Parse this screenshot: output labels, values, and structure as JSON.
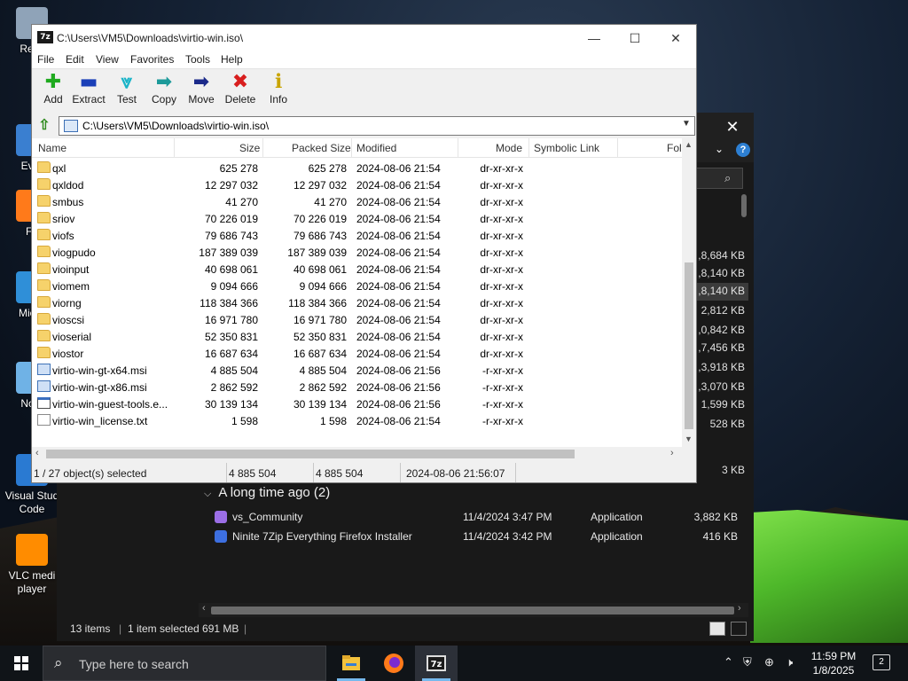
{
  "desktop": {
    "icons": [
      {
        "label": "Recy",
        "icon": "recycle-bin-icon"
      },
      {
        "label": "Ever",
        "icon": "everything-icon"
      },
      {
        "label": "Fir",
        "icon": "firefox-icon"
      },
      {
        "label": "Mic E",
        "icon": "edge-icon"
      },
      {
        "label": "Note",
        "icon": "notepad-icon"
      },
      {
        "label": "Visual Stud Code",
        "icon": "vscode-icon"
      },
      {
        "label": "VLC medi player",
        "icon": "vlc-icon"
      }
    ]
  },
  "explorer": {
    "sizes": [
      ",8,684 KB",
      ",8,140 KB",
      ",8,140 KB",
      "2,812 KB",
      ",0,842 KB",
      ",7,456 KB",
      ",3,918 KB",
      ",3,070 KB",
      "1,599 KB",
      "528 KB",
      "3 KB"
    ],
    "group_label": "A long time ago (2)",
    "rows": [
      {
        "name": "vs_Community",
        "date": "11/4/2024 3:47 PM",
        "type": "Application",
        "size": "3,882 KB",
        "icon": "visual-studio-icon"
      },
      {
        "name": "Ninite 7Zip Everything Firefox Installer",
        "date": "11/4/2024 3:42 PM",
        "type": "Application",
        "size": "416 KB",
        "icon": "ninite-icon"
      }
    ],
    "status": {
      "items": "13 items",
      "selected": "1 item selected  691 MB"
    }
  },
  "zip": {
    "title": "C:\\Users\\VM5\\Downloads\\virtio-win.iso\\",
    "app_icon_text": "7z",
    "menu": [
      "File",
      "Edit",
      "View",
      "Favorites",
      "Tools",
      "Help"
    ],
    "toolbar": [
      {
        "label": "Add",
        "icon": "add-icon",
        "glyph": "✚",
        "color": "#1faa1f"
      },
      {
        "label": "Extract",
        "icon": "extract-icon",
        "glyph": "▬",
        "color": "#1a3fb8"
      },
      {
        "label": "Test",
        "icon": "test-icon",
        "glyph": "⩔",
        "color": "#19b4c8"
      },
      {
        "label": "Copy",
        "icon": "copy-icon",
        "glyph": "➡",
        "color": "#1c9a9a"
      },
      {
        "label": "Move",
        "icon": "move-icon",
        "glyph": "➡",
        "color": "#1b2a8a"
      },
      {
        "label": "Delete",
        "icon": "delete-icon",
        "glyph": "✖",
        "color": "#d81e1e"
      },
      {
        "label": "Info",
        "icon": "info-icon",
        "glyph": "ℹ",
        "color": "#c9a400"
      }
    ],
    "address": "C:\\Users\\VM5\\Downloads\\virtio-win.iso\\",
    "columns": [
      "Name",
      "Size",
      "Packed Size",
      "Modified",
      "Mode",
      "Symbolic Link",
      "Fol"
    ],
    "files": [
      {
        "name": "qxl",
        "size": "625 278",
        "packed": "625 278",
        "modified": "2024-08-06 21:54",
        "mode": "dr-xr-xr-x",
        "type": "folder"
      },
      {
        "name": "qxldod",
        "size": "12 297 032",
        "packed": "12 297 032",
        "modified": "2024-08-06 21:54",
        "mode": "dr-xr-xr-x",
        "type": "folder"
      },
      {
        "name": "smbus",
        "size": "41 270",
        "packed": "41 270",
        "modified": "2024-08-06 21:54",
        "mode": "dr-xr-xr-x",
        "type": "folder"
      },
      {
        "name": "sriov",
        "size": "70 226 019",
        "packed": "70 226 019",
        "modified": "2024-08-06 21:54",
        "mode": "dr-xr-xr-x",
        "type": "folder"
      },
      {
        "name": "viofs",
        "size": "79 686 743",
        "packed": "79 686 743",
        "modified": "2024-08-06 21:54",
        "mode": "dr-xr-xr-x",
        "type": "folder"
      },
      {
        "name": "viogpudo",
        "size": "187 389 039",
        "packed": "187 389 039",
        "modified": "2024-08-06 21:54",
        "mode": "dr-xr-xr-x",
        "type": "folder"
      },
      {
        "name": "vioinput",
        "size": "40 698 061",
        "packed": "40 698 061",
        "modified": "2024-08-06 21:54",
        "mode": "dr-xr-xr-x",
        "type": "folder"
      },
      {
        "name": "viomem",
        "size": "9 094 666",
        "packed": "9 094 666",
        "modified": "2024-08-06 21:54",
        "mode": "dr-xr-xr-x",
        "type": "folder"
      },
      {
        "name": "viorng",
        "size": "118 384 366",
        "packed": "118 384 366",
        "modified": "2024-08-06 21:54",
        "mode": "dr-xr-xr-x",
        "type": "folder"
      },
      {
        "name": "vioscsi",
        "size": "16 971 780",
        "packed": "16 971 780",
        "modified": "2024-08-06 21:54",
        "mode": "dr-xr-xr-x",
        "type": "folder"
      },
      {
        "name": "vioserial",
        "size": "52 350 831",
        "packed": "52 350 831",
        "modified": "2024-08-06 21:54",
        "mode": "dr-xr-xr-x",
        "type": "folder"
      },
      {
        "name": "viostor",
        "size": "16 687 634",
        "packed": "16 687 634",
        "modified": "2024-08-06 21:54",
        "mode": "dr-xr-xr-x",
        "type": "folder"
      },
      {
        "name": "virtio-win-gt-x64.msi",
        "size": "4 885 504",
        "packed": "4 885 504",
        "modified": "2024-08-06 21:56",
        "mode": "-r-xr-xr-x",
        "type": "msi"
      },
      {
        "name": "virtio-win-gt-x86.msi",
        "size": "2 862 592",
        "packed": "2 862 592",
        "modified": "2024-08-06 21:56",
        "mode": "-r-xr-xr-x",
        "type": "msi"
      },
      {
        "name": "virtio-win-guest-tools.e...",
        "size": "30 139 134",
        "packed": "30 139 134",
        "modified": "2024-08-06 21:56",
        "mode": "-r-xr-xr-x",
        "type": "exe"
      },
      {
        "name": "virtio-win_license.txt",
        "size": "1 598",
        "packed": "1 598",
        "modified": "2024-08-06 21:54",
        "mode": "-r-xr-xr-x",
        "type": "txt"
      }
    ],
    "status": {
      "selection": "1 / 27 object(s) selected",
      "size": "4 885 504",
      "packed": "4 885 504",
      "modified": "2024-08-06 21:56:07"
    }
  },
  "taskbar": {
    "search_placeholder": "Type here to search",
    "time": "11:59 PM",
    "date": "1/8/2025",
    "notifications": "2"
  }
}
